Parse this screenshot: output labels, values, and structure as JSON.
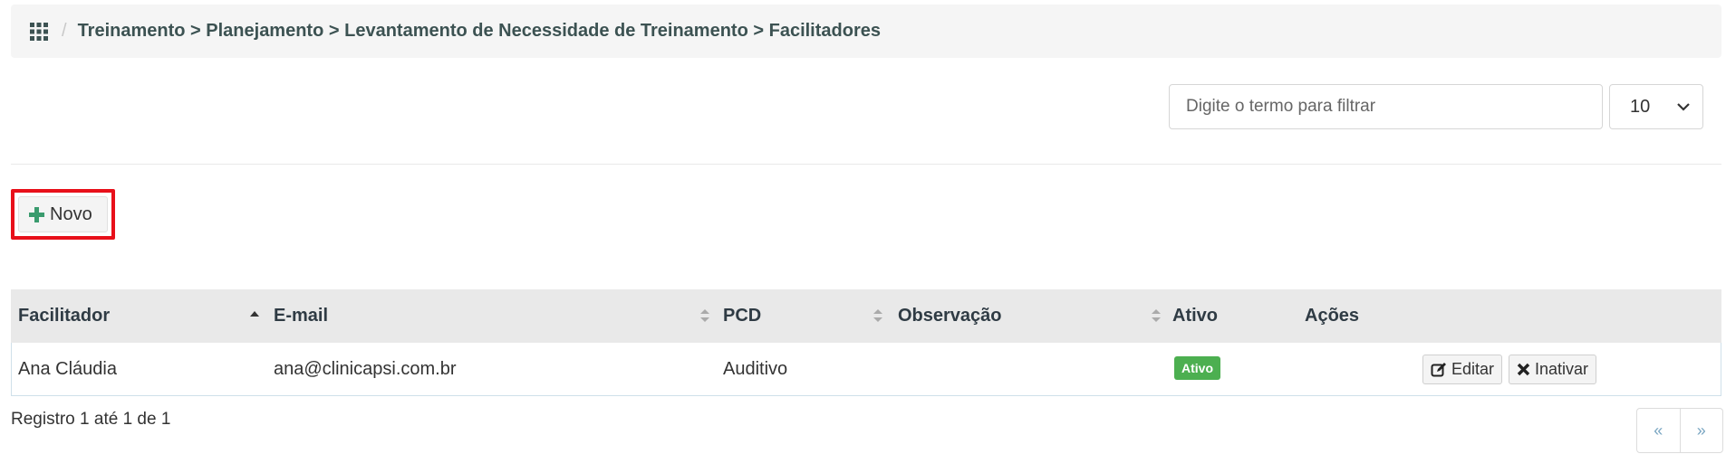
{
  "breadcrumb": {
    "icon": "apps-grid-icon",
    "path": "Treinamento > Planejamento > Levantamento de Necessidade de Treinamento > Facilitadores"
  },
  "filter": {
    "placeholder": "Digite o termo para filtrar",
    "page_size": "10"
  },
  "toolbar": {
    "new_label": "Novo"
  },
  "table": {
    "columns": [
      "Facilitador",
      "E-mail",
      "PCD",
      "Observação",
      "Ativo",
      "Ações"
    ],
    "rows": [
      {
        "facilitador": "Ana Cláudia",
        "email": "ana@clinicapsi.com.br",
        "pcd": "Auditivo",
        "observacao": "",
        "ativo": "Ativo",
        "edit_label": "Editar",
        "deactivate_label": "Inativar"
      }
    ]
  },
  "footer": {
    "info": "Registro 1 até 1 de 1",
    "prev": "«",
    "next": "»"
  },
  "colors": {
    "highlight": "#e8101a",
    "badge_active": "#4caf50",
    "plus_icon": "#3a9b6e"
  }
}
